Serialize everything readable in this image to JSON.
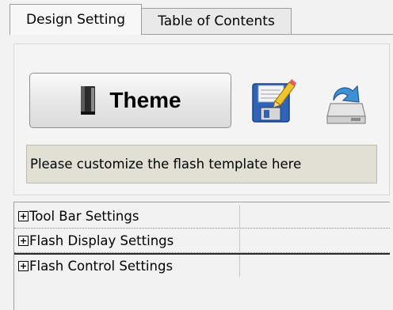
{
  "tabs": [
    {
      "label": "Design Setting",
      "active": true
    },
    {
      "label": "Table of Contents",
      "active": false
    }
  ],
  "design_panel": {
    "theme_button": {
      "label": "Theme",
      "icon": "book-icon"
    },
    "save_icon": "save-edit-icon",
    "import_icon": "import-tray-icon",
    "hint_text": "Please customize the flash template here"
  },
  "settings_tree": {
    "expander_icon": "plus-box-icon",
    "rows": [
      {
        "label": "Tool Bar Settings",
        "expanded": false,
        "selected": false
      },
      {
        "label": "Flash Display Settings",
        "expanded": false,
        "selected": false
      },
      {
        "label": "Flash Control Settings",
        "expanded": false,
        "selected": true
      }
    ]
  },
  "colors": {
    "background": "#f2f2f2",
    "hint_background": "#e0e0d4",
    "save_icon_blue": "#2f63b8",
    "import_icon_blue": "#3d8fd6"
  }
}
